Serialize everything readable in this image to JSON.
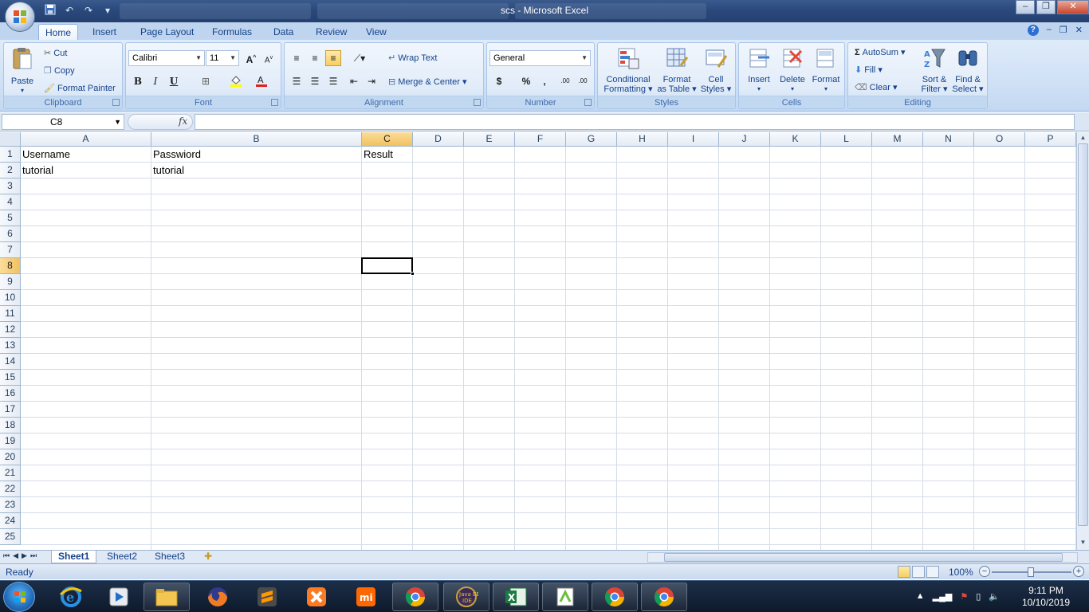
{
  "window": {
    "title": "scs - Microsoft Excel"
  },
  "window_controls": {
    "minimize": "–",
    "restore": "❐",
    "close": "✕"
  },
  "ribbon_tabs": [
    "Home",
    "Insert",
    "Page Layout",
    "Formulas",
    "Data",
    "Review",
    "View"
  ],
  "ribbon_right": {
    "help": "?",
    "minimize": "–",
    "restore": "❐",
    "close": "✕"
  },
  "clipboard": {
    "paste": "Paste",
    "cut": "Cut",
    "copy": "Copy",
    "format_painter": "Format Painter",
    "label": "Clipboard"
  },
  "font": {
    "name": "Calibri",
    "size": "11",
    "bold": "B",
    "italic": "I",
    "underline": "U",
    "grow": "A",
    "shrink": "A",
    "label": "Font"
  },
  "alignment": {
    "wrap_text": "Wrap Text",
    "merge_center": "Merge & Center",
    "label": "Alignment"
  },
  "number": {
    "format": "General",
    "currency": "$",
    "percent": "%",
    "comma": ",",
    "inc_decimal": ".00",
    "dec_decimal": ".00",
    "label": "Number"
  },
  "styles": {
    "conditional_1": "Conditional",
    "conditional_2": "Formatting",
    "table_1": "Format",
    "table_2": "as Table",
    "cell_1": "Cell",
    "cell_2": "Styles",
    "label": "Styles"
  },
  "cells": {
    "insert": "Insert",
    "delete": "Delete",
    "format": "Format",
    "label": "Cells"
  },
  "editing": {
    "autosum": "AutoSum",
    "fill": "Fill",
    "clear": "Clear",
    "sort_1": "Sort &",
    "sort_2": "Filter",
    "find_1": "Find &",
    "find_2": "Select",
    "label": "Editing"
  },
  "formula_bar": {
    "name_box": "C8",
    "fx": "fx",
    "formula": ""
  },
  "columns": [
    "A",
    "B",
    "C",
    "D",
    "E",
    "F",
    "G",
    "H",
    "I",
    "J",
    "K",
    "L",
    "M",
    "N",
    "O",
    "P"
  ],
  "rows": [
    "1",
    "2",
    "3",
    "4",
    "5",
    "6",
    "7",
    "8",
    "9",
    "10",
    "11",
    "12",
    "13",
    "14",
    "15",
    "16",
    "17",
    "18",
    "19",
    "20",
    "21",
    "22",
    "23",
    "24",
    "25"
  ],
  "cells_data": {
    "A1": "Username",
    "B1": "Passwiord",
    "C1": "Result",
    "A2": "tutorial",
    "B2": "tutorial"
  },
  "selected_cell": "C8",
  "sheets": [
    "Sheet1",
    "Sheet2",
    "Sheet3"
  ],
  "active_sheet": "Sheet1",
  "status": {
    "ready": "Ready",
    "zoom": "100%",
    "zoom_minus": "−",
    "zoom_plus": "+"
  },
  "taskbar": {
    "time": "9:11 PM",
    "date": "10/10/2019",
    "apps": [
      "internet-explorer",
      "media-player",
      "file-explorer",
      "firefox",
      "sublime-text",
      "xampp",
      "mi-pc-suite",
      "chrome",
      "java-ee-ide",
      "excel",
      "notepad-plus-plus",
      "chrome",
      "chrome"
    ]
  },
  "colors": {
    "accent": "#15428b",
    "selected_header": "#f1c15f",
    "ribbon": "#d0e1f6"
  }
}
